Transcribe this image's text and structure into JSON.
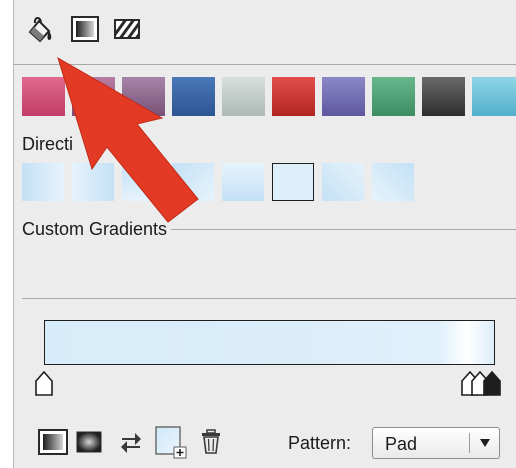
{
  "toolbar": {
    "tools": [
      {
        "icon": "paint-bucket-icon",
        "selected": true
      },
      {
        "icon": "gradient-fill-icon",
        "selected": false
      },
      {
        "icon": "pattern-fill-icon",
        "selected": false
      }
    ]
  },
  "presets": [
    {
      "top": "#e06a8e",
      "bottom": "#c23d67"
    },
    {
      "top": "#b77da2",
      "bottom": "#884a73"
    },
    {
      "top": "#a684a8",
      "bottom": "#795177"
    },
    {
      "top": "#4b78b9",
      "bottom": "#2c5594"
    },
    {
      "top": "#d7dfdc",
      "bottom": "#aebab6"
    },
    {
      "top": "#e34f4b",
      "bottom": "#b32521"
    },
    {
      "top": "#8c88c7",
      "bottom": "#5e57a0"
    },
    {
      "top": "#66b78b",
      "bottom": "#3f8e63"
    },
    {
      "top": "#6a6a6a",
      "bottom": "#2e2e2e"
    },
    {
      "top": "#8fd5e6",
      "bottom": "#52afca"
    }
  ],
  "direction": {
    "label": "Directi",
    "selected_index": 5
  },
  "custom_gradients": {
    "label": "Custom Gradients"
  },
  "gradient_editor": {
    "start_color": "#d7ecfa",
    "end_color": "#dcedf9"
  },
  "bottom_bar": {
    "pattern_label": "Pattern:",
    "pattern_value": "Pad"
  },
  "annotation": {
    "arrow_color": "#e23a25"
  }
}
